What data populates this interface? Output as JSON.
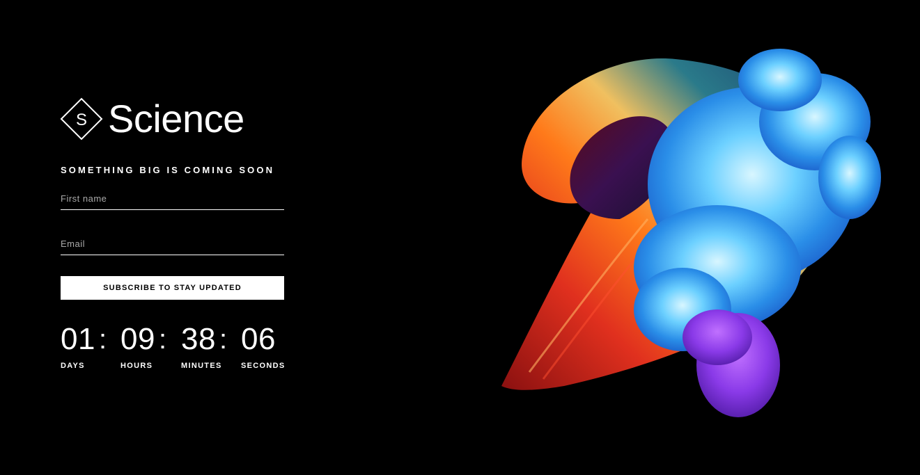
{
  "brand": {
    "name": "Science",
    "mark_letter": "S"
  },
  "hero": {
    "tagline": "SOMETHING BIG IS COMING SOON"
  },
  "form": {
    "first_name_placeholder": "First name",
    "first_name_value": "",
    "email_placeholder": "Email",
    "email_value": "",
    "subscribe_label": "SUBSCRIBE TO STAY UPDATED"
  },
  "countdown": {
    "separator": ":",
    "units": [
      {
        "value": "01",
        "label": "DAYS"
      },
      {
        "value": "09",
        "label": "HOURS"
      },
      {
        "value": "38",
        "label": "MINUTES"
      },
      {
        "value": "06",
        "label": "SECONDS"
      }
    ]
  },
  "colors": {
    "background": "#000000",
    "text": "#ffffff",
    "button_bg": "#ffffff",
    "button_text": "#000000"
  }
}
